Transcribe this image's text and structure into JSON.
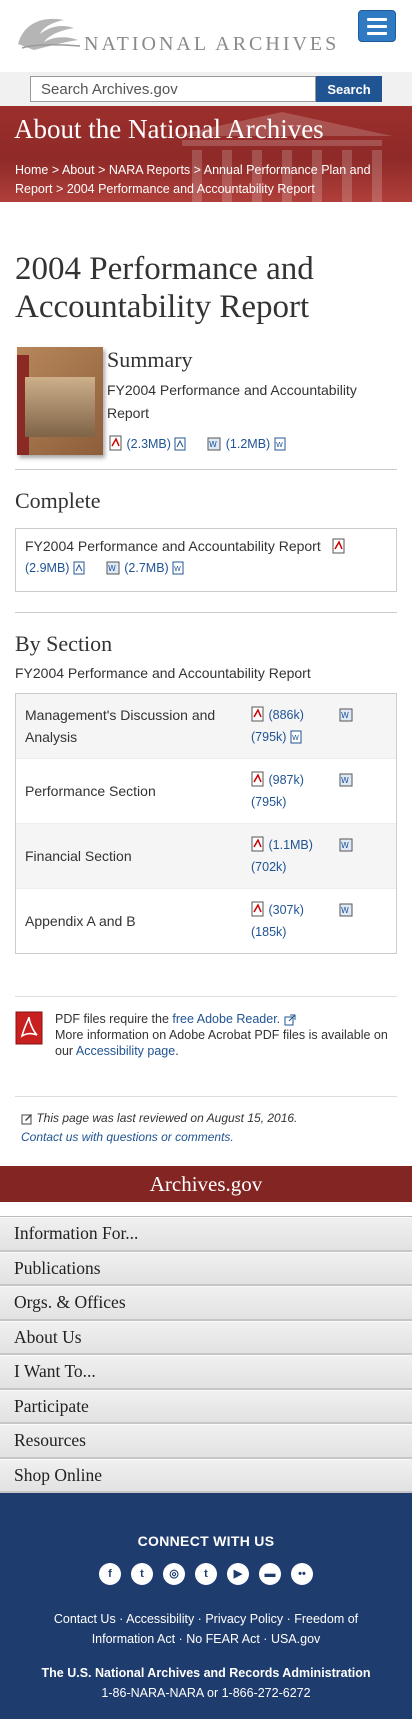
{
  "header": {
    "logo_text": "NATIONAL ARCHIVES",
    "menu_icon": "hamburger-menu-icon"
  },
  "search": {
    "placeholder": "Search Archives.gov",
    "button_label": "Search"
  },
  "hero": {
    "title": "About the National Archives",
    "breadcrumb": [
      "Home",
      "About",
      "NARA Reports",
      "Annual Performance Plan and Report",
      "2004 Performance and Accountability Report"
    ],
    "separator": ">"
  },
  "page": {
    "title": "2004 Performance and Accountability Report"
  },
  "summary": {
    "heading": "Summary",
    "subtitle": "FY2004 Performance and Accountability Report",
    "pdf_size": "(2.3MB)",
    "word_size": "(1.2MB)"
  },
  "complete": {
    "heading": "Complete",
    "title": "FY2004 Performance and Accountability Report",
    "pdf_size": "(2.9MB)",
    "word_size": "(2.7MB)"
  },
  "by_section": {
    "heading": "By Section",
    "subtitle": "FY2004 Performance and Accountability Report",
    "rows": [
      {
        "label": "Management's Discussion and Analysis",
        "pdf_size": "(886k)",
        "word_size": "(795k)"
      },
      {
        "label": "Performance Section",
        "pdf_size": "(987k)",
        "word_size": "(795k)"
      },
      {
        "label": "Financial Section",
        "pdf_size": "(1.1MB)",
        "word_size": "(702k)"
      },
      {
        "label": "Appendix A and B",
        "pdf_size": "(307k)",
        "word_size": "(185k)"
      }
    ]
  },
  "pdf_note": {
    "line1_pre": "PDF files require the ",
    "line1_link": "free Adobe Reader.",
    "line2": "More information on Adobe Acrobat PDF files is available on our ",
    "line2_link": "Accessibility page",
    "line2_post": "."
  },
  "review": {
    "reviewed_text": "This page was last reviewed on August 15, 2016.",
    "contact_link": "Contact us with questions or comments."
  },
  "footer": {
    "title": "Archives.gov",
    "nav": [
      "Information For...",
      "Publications",
      "Orgs. & Offices",
      "About Us",
      "I Want To...",
      "Participate",
      "Resources",
      "Shop Online"
    ],
    "connect_title": "CONNECT WITH US",
    "social_icons": [
      "facebook-icon",
      "twitter-icon",
      "instagram-icon",
      "tumblr-icon",
      "youtube-icon",
      "blog-icon",
      "flickr-icon"
    ],
    "links": [
      "Contact Us",
      "Accessibility",
      "Privacy Policy",
      "Freedom of Information Act",
      "No FEAR Act",
      "USA.gov"
    ],
    "org_name": "The U.S. National Archives and Records Administration",
    "phone": "1-86-NARA-NARA or 1-866-272-6272"
  },
  "colors": {
    "hero_red": "#8e2a28",
    "link_blue": "#205493",
    "footer_navy": "#1f3c6e",
    "menu_blue": "#2e7bc4"
  }
}
